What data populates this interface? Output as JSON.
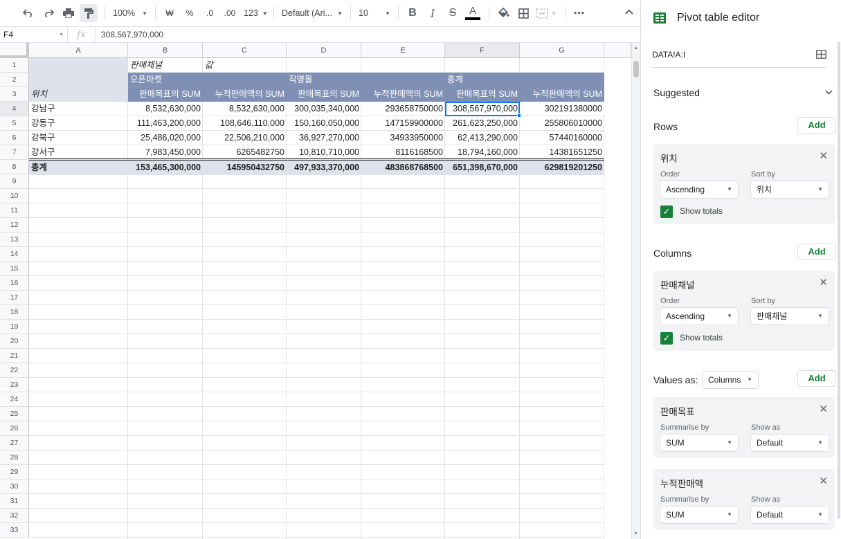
{
  "toolbar": {
    "zoom": "100%",
    "currency": "₩",
    "percent": "%",
    "dec_decrease": ".0",
    "dec_increase": ".00",
    "more_formats": "123",
    "font": "Default (Ari...",
    "font_size": "10",
    "bold": "B",
    "italic": "I",
    "strike": "S",
    "text_color": "A"
  },
  "formula_bar": {
    "cell_ref": "F4",
    "fx": "fx",
    "value": "308,567,970,000"
  },
  "columns": [
    "A",
    "B",
    "C",
    "D",
    "E",
    "F",
    "G"
  ],
  "rows": [
    "1",
    "2",
    "3",
    "4",
    "5",
    "6",
    "7",
    "8",
    "9",
    "10",
    "11",
    "12",
    "13",
    "14",
    "15",
    "16",
    "17",
    "18",
    "19",
    "20",
    "21",
    "22",
    "23",
    "24",
    "25",
    "26",
    "27",
    "28",
    "29",
    "30",
    "31",
    "32",
    "33"
  ],
  "pivot": {
    "row1": {
      "b": "판매채널",
      "c": "값"
    },
    "row2": {
      "open": "오픈마켓",
      "direct": "직영몰",
      "total": "총계"
    },
    "row3": {
      "a": "위치",
      "b": "판매목표의 SUM",
      "c": "누적판매액의 SUM",
      "d": "판매목표의 SUM",
      "e": "누적판매액의 SUM",
      "f": "판매목표의 SUM",
      "g": "누적판매액의 SUM"
    },
    "data": [
      {
        "a": "강남구",
        "b": "8,532,630,000",
        "c": "8,532,630,000",
        "d": "300,035,340,000",
        "e": "293658750000",
        "f": "308,567,970,000",
        "g": "302191380000"
      },
      {
        "a": "강동구",
        "b": "111,463,200,000",
        "c": "108,646,110,000",
        "d": "150,160,050,000",
        "e": "147159900000",
        "f": "261,623,250,000",
        "g": "255806010000"
      },
      {
        "a": "강북구",
        "b": "25,486,020,000",
        "c": "22,506,210,000",
        "d": "36,927,270,000",
        "e": "34933950000",
        "f": "62,413,290,000",
        "g": "57440160000"
      },
      {
        "a": "강서구",
        "b": "7,983,450,000",
        "c": "6265482750",
        "d": "10,810,710,000",
        "e": "8116168500",
        "f": "18,794,160,000",
        "g": "14381651250"
      }
    ],
    "total": {
      "a": "총계",
      "b": "153,465,300,000",
      "c": "145950432750",
      "d": "497,933,370,000",
      "e": "483868768500",
      "f": "651,398,670,000",
      "g": "629819201250"
    }
  },
  "panel": {
    "title": "Pivot table editor",
    "range": "DATA!A:I",
    "suggested": "Suggested",
    "rows_label": "Rows",
    "columns_label": "Columns",
    "values_label": "Values as:",
    "values_as": "Columns",
    "add": "Add",
    "order_label": "Order",
    "sortby_label": "Sort by",
    "show_totals": "Show totals",
    "summarise_label": "Summarise by",
    "showas_label": "Show as",
    "row_card": {
      "name": "위치",
      "order": "Ascending",
      "sortby": "위치"
    },
    "col_card": {
      "name": "판매채널",
      "order": "Ascending",
      "sortby": "판매채널"
    },
    "val_card1": {
      "name": "판매목표",
      "summarise": "SUM",
      "showas": "Default"
    },
    "val_card2": {
      "name": "누적판매액",
      "summarise": "SUM",
      "showas": "Default"
    }
  }
}
